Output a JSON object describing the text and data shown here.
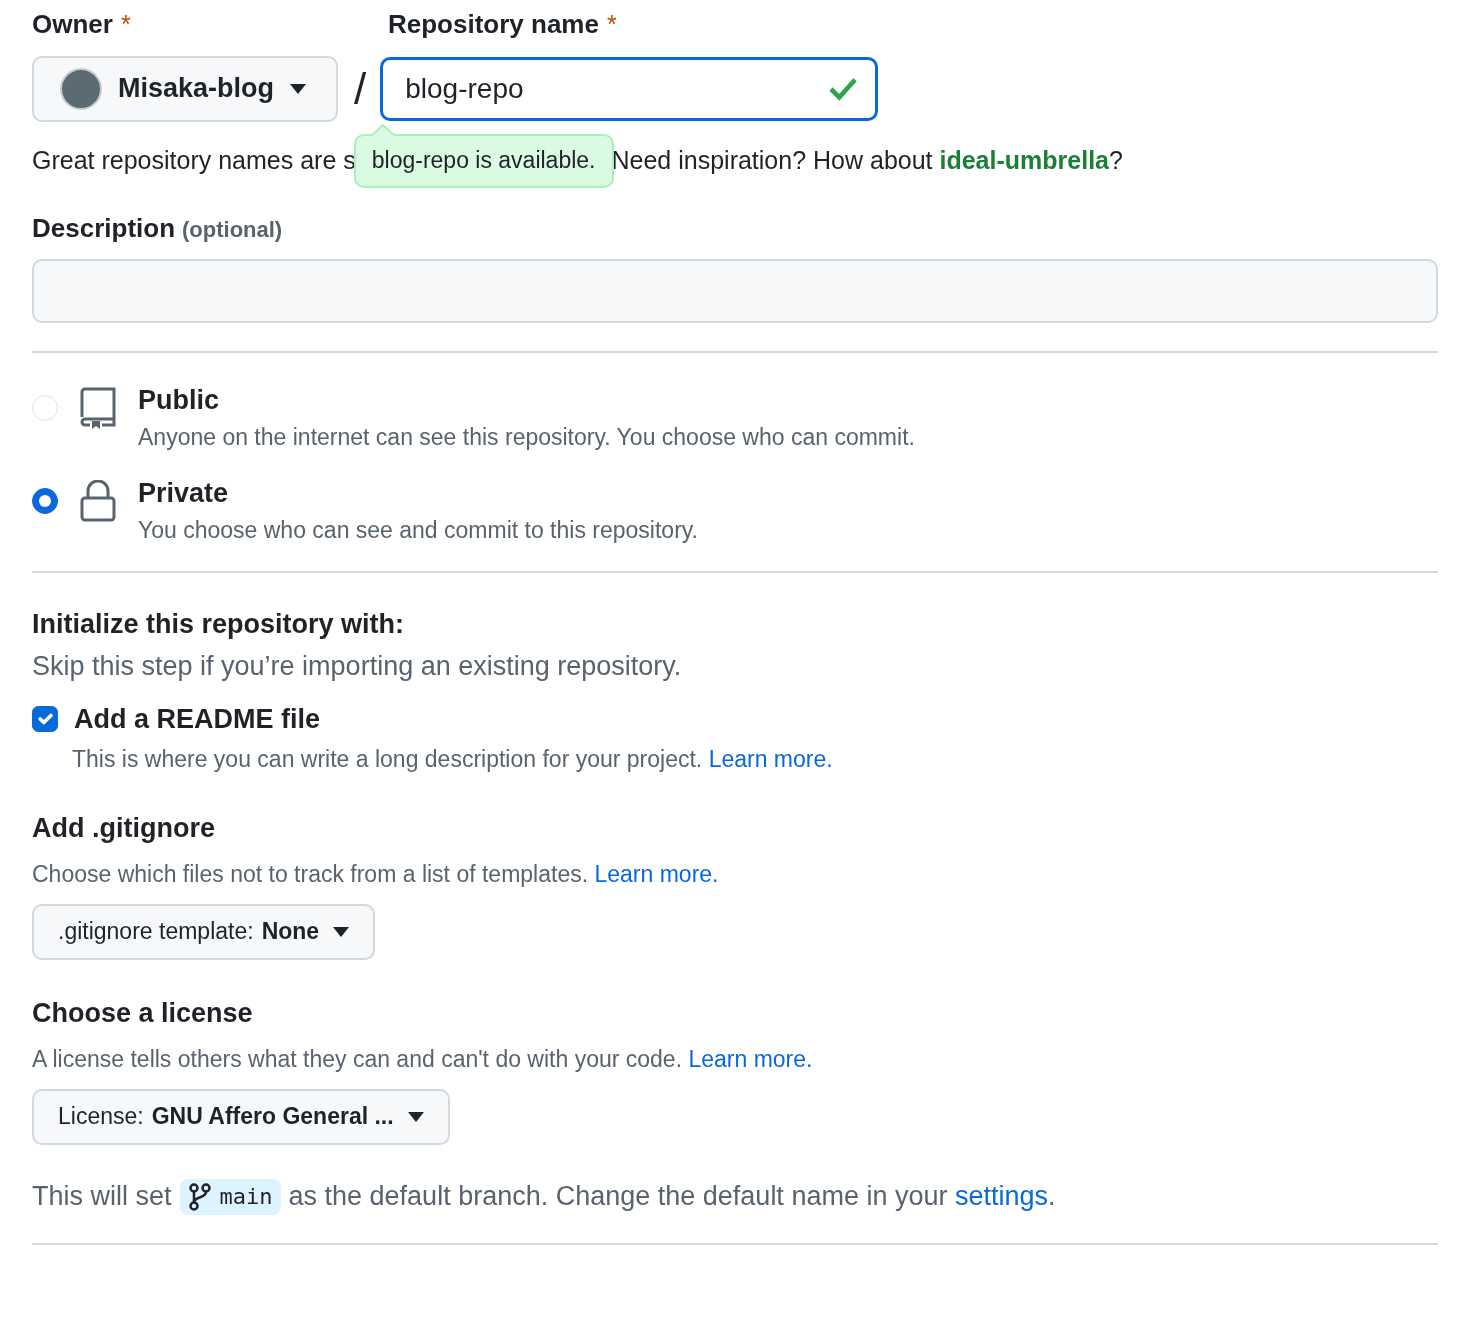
{
  "owner": {
    "label": "Owner",
    "required_mark": "*",
    "name": "Misaka-blog"
  },
  "separator": "/",
  "repo_name": {
    "label": "Repository name",
    "required_mark": "*",
    "value": "blog-repo",
    "valid": true
  },
  "availability_tooltip": "blog-repo is available.",
  "hint": {
    "before": "Great repository names are s",
    "after": "Need inspiration? How about ",
    "suggestion": "ideal-umbrella",
    "end": "?"
  },
  "description": {
    "label": "Description",
    "optional": "(optional)"
  },
  "visibility": [
    {
      "kind": "repo",
      "label": "Public",
      "description": "Anyone on the internet can see this repository. You choose who can commit.",
      "selected": false
    },
    {
      "kind": "lock",
      "label": "Private",
      "description": "You choose who can see and commit to this repository.",
      "selected": true
    }
  ],
  "initialize": {
    "title": "Initialize this repository with:",
    "subtitle": "Skip this step if you’re importing an existing repository.",
    "readme": {
      "label": "Add a README file",
      "checked": true,
      "description": "This is where you can write a long description for your project. ",
      "link": "Learn more."
    }
  },
  "gitignore": {
    "title": "Add .gitignore",
    "description": "Choose which files not to track from a list of templates. ",
    "link": "Learn more.",
    "button_prefix": ".gitignore template: ",
    "button_value": "None"
  },
  "license": {
    "title": "Choose a license",
    "description": "A license tells others what they can and can't do with your code. ",
    "link": "Learn more.",
    "button_prefix": "License: ",
    "button_value": "GNU Affero General ..."
  },
  "branch": {
    "before": "This will set",
    "name": "main",
    "after": "as the default branch. Change the default name in your ",
    "link": "settings",
    "end": "."
  }
}
